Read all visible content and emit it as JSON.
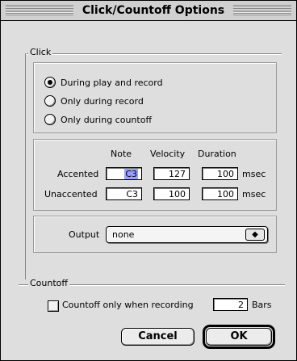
{
  "window": {
    "title": "Click/Countoff Options"
  },
  "click_group": {
    "label": "Click",
    "radios": [
      {
        "label": "During play and record",
        "selected": true
      },
      {
        "label": "Only during record",
        "selected": false
      },
      {
        "label": "Only during countoff",
        "selected": false
      }
    ],
    "columns": {
      "note": "Note",
      "velocity": "Velocity",
      "duration": "Duration"
    },
    "rows": [
      {
        "label": "Accented",
        "note": "C3",
        "velocity": "127",
        "duration": "100",
        "unit": "msec"
      },
      {
        "label": "Unaccented",
        "note": "C3",
        "velocity": "100",
        "duration": "100",
        "unit": "msec"
      }
    ],
    "output": {
      "label": "Output",
      "value": "none"
    }
  },
  "countoff_group": {
    "label": "Countoff",
    "checkbox_label": "Countoff only when recording",
    "checked": false,
    "bars_value": "2",
    "bars_unit": "Bars"
  },
  "buttons": {
    "cancel": "Cancel",
    "ok": "OK"
  },
  "colors": {
    "selection": "#9aa0ff",
    "window_bg": "#dedede"
  }
}
